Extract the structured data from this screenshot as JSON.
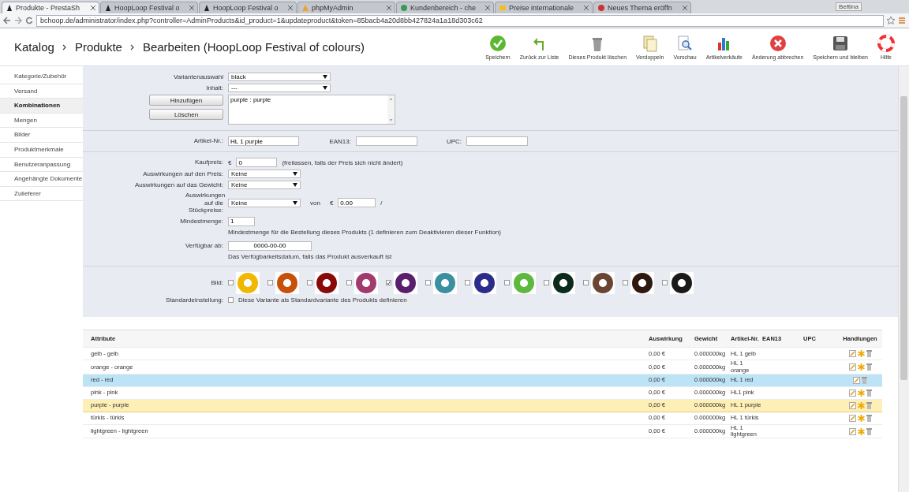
{
  "browser": {
    "tabs": [
      {
        "label": "Produkte - PrestaSh",
        "selected": true
      },
      {
        "label": "HoopLoop Festival o",
        "selected": false
      },
      {
        "label": "HoopLoop Festival o",
        "selected": false
      },
      {
        "label": "phpMyAdmin",
        "selected": false
      },
      {
        "label": "Kundenbereich - che",
        "selected": false
      },
      {
        "label": "Preise internationale",
        "selected": false
      },
      {
        "label": "Neues Thema eröffn",
        "selected": false
      }
    ],
    "user": "Bettina",
    "url": "bchoop.de/administrator/index.php?controller=AdminProducts&id_product=1&updateproduct&token=85bacb4a20d8bb427824a1a18d303c62"
  },
  "breadcrumb": [
    "Katalog",
    "Produkte",
    "Bearbeiten (HoopLoop Festival of colours)"
  ],
  "toolbar": [
    {
      "label": "Speichern",
      "kind": "save"
    },
    {
      "label": "Zurück zur Liste",
      "kind": "back"
    },
    {
      "label": "Dieses Produkt löschen",
      "kind": "delete"
    },
    {
      "label": "Verdoppeln",
      "kind": "duplicate"
    },
    {
      "label": "Vorschau",
      "kind": "preview"
    },
    {
      "label": "Artikelverkäufe",
      "kind": "stats"
    },
    {
      "label": "Änderung abbrechen",
      "kind": "cancel"
    },
    {
      "label": "Speichern und bleiben",
      "kind": "saveStay"
    },
    {
      "label": "Hilfe",
      "kind": "help"
    }
  ],
  "sidebar": {
    "items": [
      {
        "label": "Kategorie/Zubehör",
        "selected": false
      },
      {
        "label": "Versand",
        "selected": false
      },
      {
        "label": "Kombinationen",
        "selected": true
      },
      {
        "label": "Mengen",
        "selected": false
      },
      {
        "label": "Bilder",
        "selected": false
      },
      {
        "label": "Produktmerkmale",
        "selected": false
      },
      {
        "label": "Benutzeranpassung",
        "selected": false
      },
      {
        "label": "Angehängte Dokumente",
        "selected": false
      },
      {
        "label": "Zulieferer",
        "selected": false
      }
    ]
  },
  "form": {
    "variant": {
      "label": "Variantenauswahl",
      "value": "black"
    },
    "content": {
      "label": "Inhalt:",
      "value": "---"
    },
    "add_button": "Hinzufügen",
    "delete_button": "Löschen",
    "attribute_list": [
      "purple : purple"
    ],
    "reference": {
      "label": "Artikel-Nr.:",
      "value": "HL 1 purple"
    },
    "ean13": {
      "label": "EAN13:"
    },
    "upc": {
      "label": "UPC:"
    },
    "wholesale": {
      "label": "Kaufpreis:",
      "currency": "€",
      "value": "0",
      "note": "(freilassen, falls der Preis sich nicht ändert)"
    },
    "price_impact": {
      "label": "Auswirkungen auf den Preis:",
      "value": "Keine"
    },
    "weight_impact": {
      "label": "Auswirkungen auf das Gewicht:",
      "value": "Keine"
    },
    "unit_impact": {
      "label": "Auswirkungen auf die Stückpreise:",
      "value": "Keine",
      "of": "von",
      "currency": "€",
      "amount": "0.00",
      "suffix": "/"
    },
    "minimal_quantity": {
      "label": "Mindestmenge:",
      "value": "1",
      "note": "Mindestmenge für die Bestellung dieses Produkts (1 definieren zum Deaktivieren dieser Funktion)"
    },
    "available_date": {
      "label": "Verfügbar ab:",
      "value": "0000-00-00",
      "note": "Das Verfügbarkeitsdatum, falls das Produkt ausverkauft ist"
    },
    "images": {
      "label": "Bild:",
      "items": [
        {
          "checked": false,
          "color": "#f0b800"
        },
        {
          "checked": false,
          "color": "#c8500a"
        },
        {
          "checked": false,
          "color": "#8a0808"
        },
        {
          "checked": false,
          "color": "#a33a6f"
        },
        {
          "checked": true,
          "color": "#5a1f6c"
        },
        {
          "checked": false,
          "color": "#3a8fa0"
        },
        {
          "checked": false,
          "color": "#2b2b8a"
        },
        {
          "checked": false,
          "color": "#5db840"
        },
        {
          "checked": false,
          "color": "#0c2a1c"
        },
        {
          "checked": false,
          "color": "#6a4632"
        },
        {
          "checked": false,
          "color": "#2e1810"
        },
        {
          "checked": false,
          "color": "#1a1a1a"
        }
      ]
    },
    "default": {
      "label": "Standardeinstellung:",
      "checked": false,
      "text": "Diese Variante als Standardvariante des Produkts definieren"
    }
  },
  "table": {
    "columns": [
      "Attribute",
      "Auswirkung",
      "Gewicht",
      "Artikel-Nr.",
      "EAN13",
      "UPC",
      "Handlungen"
    ],
    "rows": [
      {
        "attribute": "gelb - gelb",
        "impact": "0,00 €",
        "weight": "0.000000kg",
        "reference": "HL 1 gelb",
        "selected": false,
        "hovered": false,
        "is_default": false
      },
      {
        "attribute": "orange - orange",
        "impact": "0,00 €",
        "weight": "0.000000kg",
        "reference": "HL 1 orange",
        "selected": false,
        "hovered": false,
        "is_default": false
      },
      {
        "attribute": "red - red",
        "impact": "0,00 €",
        "weight": "0.000000kg",
        "reference": "HL 1 red",
        "selected": false,
        "hovered": true,
        "is_default": true
      },
      {
        "attribute": "pink - pink",
        "impact": "0,00 €",
        "weight": "0.000000kg",
        "reference": "HL1 pink",
        "selected": false,
        "hovered": false,
        "is_default": false
      },
      {
        "attribute": "purple - purple",
        "impact": "0,00 €",
        "weight": "0.000000kg",
        "reference": "HL 1 purple",
        "selected": true,
        "hovered": false,
        "is_default": false
      },
      {
        "attribute": "türkis - türkis",
        "impact": "0,00 €",
        "weight": "0.000000kg",
        "reference": "HL 1 türkis",
        "selected": false,
        "hovered": false,
        "is_default": false
      },
      {
        "attribute": "lightgreen - lightgreen",
        "impact": "0,00 €",
        "weight": "0.000000kg",
        "reference": "HL 1 lightgreen",
        "selected": false,
        "hovered": false,
        "is_default": false
      }
    ]
  }
}
